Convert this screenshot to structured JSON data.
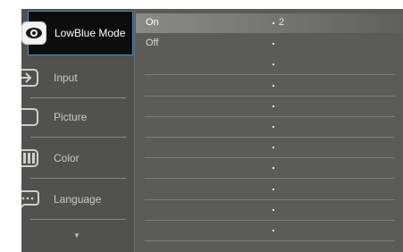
{
  "menu": {
    "items": [
      {
        "label": "LowBlue Mode",
        "icon": "eye-icon",
        "selected": true
      },
      {
        "label": "Input",
        "icon": "input-arrow-icon",
        "selected": false
      },
      {
        "label": "Picture",
        "icon": "picture-icon",
        "selected": false
      },
      {
        "label": "Color",
        "icon": "color-bars-icon",
        "selected": false
      },
      {
        "label": "Language",
        "icon": "speech-bubble-icon",
        "selected": false
      }
    ],
    "scroll_down_icon": "triangle-down-icon"
  },
  "options": {
    "items": [
      {
        "label": "On",
        "selected": true
      },
      {
        "label": "Off",
        "selected": false
      }
    ]
  },
  "level": {
    "value": "2",
    "steps": 11
  },
  "colors": {
    "osd_background": "#5b5b58",
    "sidebar_background": "#515150",
    "selected_background": "#0d0d0d",
    "selected_border": "#4a90c6",
    "text": "#c9c9c6"
  }
}
